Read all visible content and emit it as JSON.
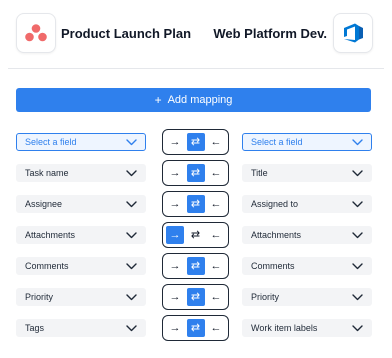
{
  "header": {
    "left_app": "Product Launch Plan",
    "right_app": "Web Platform Dev."
  },
  "add_mapping_label": "Add mapping",
  "icons": {
    "left_logo": "asana-logo-icon",
    "right_logo": "azure-devops-logo-icon",
    "chevron": "chevron-down-icon",
    "arrow_right": "arrow-right-icon",
    "arrow_both": "arrows-bidirectional-icon",
    "arrow_left": "arrow-left-icon"
  },
  "colors": {
    "accent": "#2f80ed",
    "asana": "#f06a6a",
    "azure": "#0078d4"
  },
  "direction_symbols": {
    "right": "→",
    "both": "⇄",
    "left": "←"
  },
  "mappings": [
    {
      "left": "Select a field",
      "right": "Select a field",
      "direction": "both",
      "placeholder": true
    },
    {
      "left": "Task name",
      "right": "Title",
      "direction": "both"
    },
    {
      "left": "Assignee",
      "right": "Assigned to",
      "direction": "both"
    },
    {
      "left": "Attachments",
      "right": "Attachments",
      "direction": "right"
    },
    {
      "left": "Comments",
      "right": "Comments",
      "direction": "both"
    },
    {
      "left": "Priority",
      "right": "Priority",
      "direction": "both"
    },
    {
      "left": "Tags",
      "right": "Work item labels",
      "direction": "both"
    }
  ]
}
